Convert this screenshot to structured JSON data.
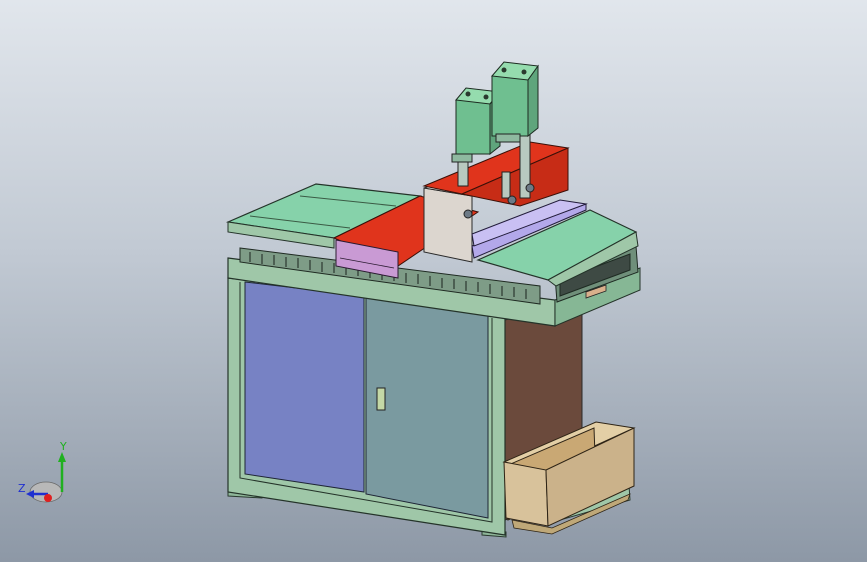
{
  "viewport": {
    "description_colors": {
      "background_top": "#e1e6ec",
      "background_bottom": "#8d98a6",
      "frame": "#9fc7a8",
      "table_top": "#86d2aa",
      "door_left": "#7782c4",
      "door_right": "#7a9aa0",
      "red_plate": "#e0341c",
      "pink_plate": "#c99ad4",
      "violet_plate": "#b3a8ea",
      "cylinder": "#6fbf90",
      "brown_panel": "#6b4a3c",
      "tray": "#d8c29b"
    }
  },
  "triad": {
    "y_label": "Y",
    "z_label": "Z",
    "x_color": "#e02020",
    "y_color": "#20b020",
    "z_color": "#2030d0"
  }
}
